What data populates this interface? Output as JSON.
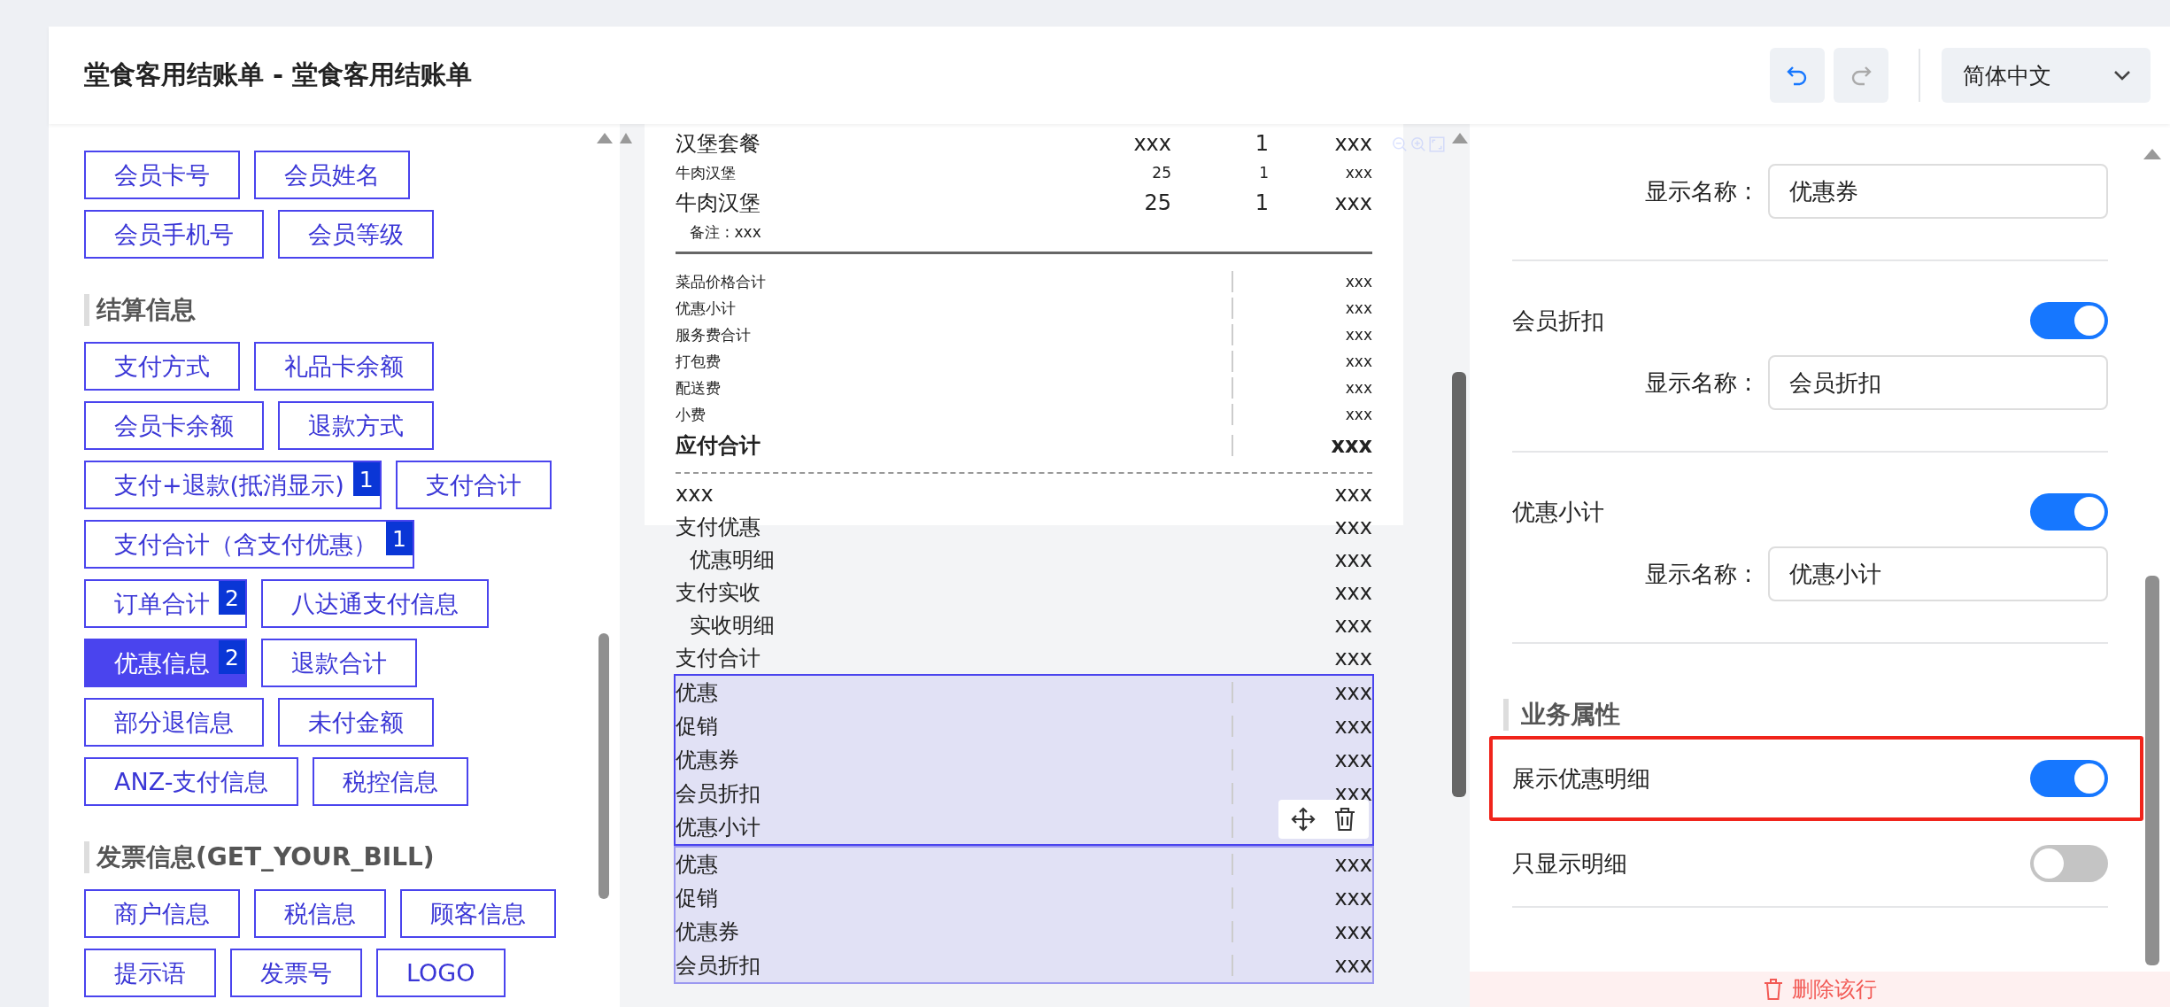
{
  "header": {
    "title": "堂食客用结账单 - 堂食客用结账单",
    "language": "简体中文"
  },
  "left_panel": {
    "sections": [
      {
        "fields": [
          {
            "label": "会员卡号",
            "selected": false
          },
          {
            "label": "会员姓名",
            "selected": false
          },
          {
            "label": "会员手机号",
            "selected": false
          },
          {
            "label": "会员等级",
            "selected": false
          }
        ]
      },
      {
        "title": "结算信息",
        "fields": [
          {
            "label": "支付方式",
            "selected": false
          },
          {
            "label": "礼品卡余额",
            "selected": false
          },
          {
            "label": "会员卡余额",
            "selected": false
          },
          {
            "label": "退款方式",
            "selected": false
          },
          {
            "label": "支付+退款(抵消显示)",
            "badge": "1",
            "selected": false
          },
          {
            "label": "支付合计",
            "selected": false
          },
          {
            "label": "支付合计（含支付优惠）",
            "badge": "1",
            "selected": false
          },
          {
            "label": "订单合计",
            "badge": "2",
            "selected": false
          },
          {
            "label": "八达通支付信息",
            "selected": false
          },
          {
            "label": "优惠信息",
            "badge": "2",
            "selected": true
          },
          {
            "label": "退款合计",
            "selected": false
          },
          {
            "label": "部分退信息",
            "selected": false
          },
          {
            "label": "未付金额",
            "selected": false
          },
          {
            "label": "ANZ-支付信息",
            "selected": false
          },
          {
            "label": "税控信息",
            "selected": false
          }
        ]
      },
      {
        "title": "发票信息(GET_YOUR_BILL)",
        "fields": [
          {
            "label": "商户信息",
            "selected": false
          },
          {
            "label": "税信息",
            "selected": false
          },
          {
            "label": "顾客信息",
            "selected": false
          },
          {
            "label": "提示语",
            "selected": false
          },
          {
            "label": "发票号",
            "selected": false
          },
          {
            "label": "LOGO",
            "selected": false
          }
        ]
      }
    ]
  },
  "receipt": {
    "items": [
      {
        "kind": "large",
        "name": "汉堡套餐",
        "price": "xxx",
        "qty": "1",
        "amount": "xxx"
      },
      {
        "kind": "small",
        "name": "牛肉汉堡",
        "price": "25",
        "qty": "1",
        "amount": "xxx"
      },
      {
        "kind": "large",
        "name": "牛肉汉堡",
        "price": "25",
        "qty": "1",
        "amount": "xxx"
      }
    ],
    "note": "备注 : xxx",
    "subtotals": [
      {
        "label": "菜品价格合计",
        "value": "xxx"
      },
      {
        "label": "优惠小计",
        "value": "xxx"
      },
      {
        "label": "服务费合计",
        "value": "xxx"
      },
      {
        "label": "打包费",
        "value": "xxx"
      },
      {
        "label": "配送费",
        "value": "xxx"
      },
      {
        "label": "小费",
        "value": "xxx"
      }
    ],
    "total": {
      "label": "应付合计",
      "value": "xxx"
    },
    "payments": [
      {
        "kind": "main",
        "label": "xxx",
        "value": "xxx"
      },
      {
        "kind": "main",
        "label": "支付优惠",
        "value": "xxx"
      },
      {
        "kind": "detail",
        "label": "优惠明细",
        "value": "xxx"
      },
      {
        "kind": "main",
        "label": "支付实收",
        "value": "xxx"
      },
      {
        "kind": "detail",
        "label": "实收明细",
        "value": "xxx"
      },
      {
        "kind": "main",
        "label": "支付合计",
        "value": "xxx"
      }
    ],
    "groups": [
      {
        "selected": true,
        "rows": [
          {
            "label": "优惠",
            "value": "xxx"
          },
          {
            "label": "促销",
            "value": "xxx"
          },
          {
            "label": "优惠券",
            "value": "xxx"
          },
          {
            "label": "会员折扣",
            "value": "xxx"
          },
          {
            "label": "优惠小计"
          }
        ]
      },
      {
        "selected": false,
        "rows": [
          {
            "label": "优惠",
            "value": "xxx"
          },
          {
            "label": "促销",
            "value": "xxx"
          },
          {
            "label": "优惠券",
            "value": "xxx"
          },
          {
            "label": "会员折扣",
            "value": "xxx"
          }
        ]
      }
    ]
  },
  "settings": {
    "groups": [
      {
        "field": {
          "label": "显示名称 :",
          "value": "优惠券"
        }
      },
      {
        "toggle": {
          "label": "会员折扣",
          "on": true
        },
        "field": {
          "label": "显示名称 :",
          "value": "会员折扣"
        }
      },
      {
        "toggle": {
          "label": "优惠小计",
          "on": true
        },
        "field": {
          "label": "显示名称 :",
          "value": "优惠小计"
        }
      }
    ],
    "section_title": "业务属性",
    "options": [
      {
        "label": "展示优惠明细",
        "on": true,
        "highlighted": true
      },
      {
        "label": "只显示明细",
        "on": false,
        "highlighted": false
      }
    ],
    "delete_button": "删除该行"
  }
}
